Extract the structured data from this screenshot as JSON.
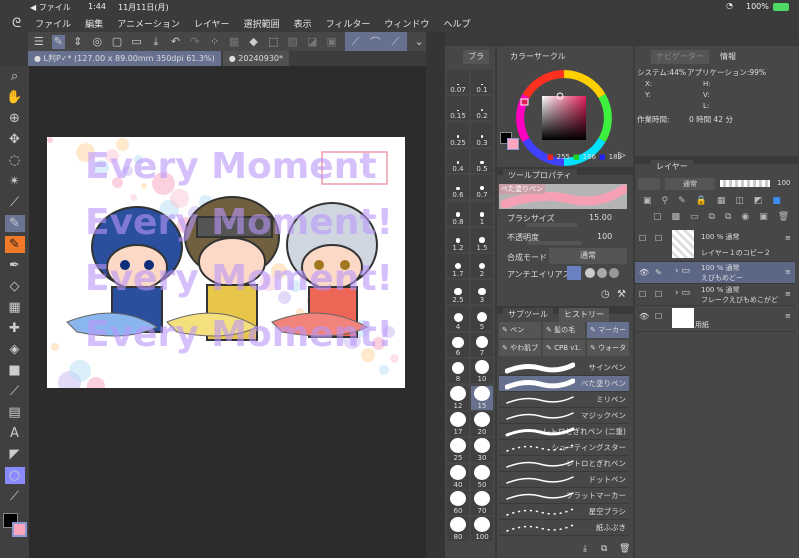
{
  "status": {
    "back": "◀ ファイル",
    "time": "1:44",
    "date": "11月11日(月)",
    "battery": "100%"
  },
  "menu": [
    "ファイル",
    "編集",
    "アニメーション",
    "レイヤー",
    "選択範囲",
    "表示",
    "フィルター",
    "ウィンドウ",
    "ヘルプ"
  ],
  "doc_tabs": [
    {
      "label": "● L判P✓* (127.00 x 89.00mm 350dpi 61.3%)",
      "active": true
    },
    {
      "label": "● 20240930*",
      "active": false
    }
  ],
  "artwork": {
    "text_lines": [
      "Every Moment",
      "Every Moment!",
      "Every Moment!",
      "Every Moment!"
    ]
  },
  "brush_panel": {
    "tab": "ブラ",
    "sizes": [
      "0.07",
      "0.1",
      "0.15",
      "0.2",
      "0.25",
      "0.3",
      "0.4",
      "0.5",
      "0.6",
      "0.7",
      "0.8",
      "1",
      "1.2",
      "1.5",
      "1.7",
      "2",
      "2.5",
      "3",
      "4",
      "5",
      "6",
      "7",
      "8",
      "10",
      "12",
      "15",
      "17",
      "20",
      "25",
      "30",
      "40",
      "50",
      "60",
      "70",
      "80",
      "100"
    ],
    "selected": "15"
  },
  "color_panel": {
    "tab": "カラーサークル",
    "r": "255",
    "g": "166",
    "b": "189",
    "main_color": "#000000",
    "sub_color": "#ffa6bd"
  },
  "tool_property": {
    "tab": "ツールプロパティ",
    "tool_name": "べた塗りペン",
    "brush_size_label": "ブラシサイズ",
    "brush_size": "15.00",
    "opacity_label": "不透明度",
    "opacity": "100",
    "blend_label": "合成モード",
    "blend": "通常",
    "aa_label": "アンチエイリアス"
  },
  "subtool": {
    "tab": "サブツール",
    "tab2": "ヒストリー",
    "groups": [
      "ペン",
      "髪の毛",
      "マーカー",
      "やわ肌ブ",
      "CPB v1.",
      "ウォータ"
    ],
    "items": [
      "サインペン",
      "べた塗りペン",
      "ミリペン",
      "マジックペン",
      "レトロとぎれペン (二重)",
      "シューティングスター",
      "レトロとぎれペン",
      "ドットペン",
      "フラットマーカー",
      "星空ブラシ",
      "紙ふぶき"
    ],
    "selected": "べた塗りペン"
  },
  "info_panel": {
    "tab_nav": "ナビゲーター",
    "tab": "情報",
    "system": "システム:44%",
    "app": "アプリケーション:99%",
    "x": "X:",
    "y": "Y:",
    "h": "H:",
    "v": "V:",
    "l": "L:",
    "work_time_label": "作業時間:",
    "work_time": "0 時間 42 分"
  },
  "layer_panel": {
    "tab": "レイヤー",
    "blend": "通常",
    "opacity": "100",
    "layers": [
      {
        "meta": "100 % 通常",
        "name": "レイヤー１のコピー２",
        "visible": false,
        "folder": false,
        "selected": false
      },
      {
        "meta": "100 % 通常",
        "name": "えびもめどー",
        "visible": true,
        "folder": true,
        "selected": true
      },
      {
        "meta": "100 % 通常",
        "name": "フレークえびもめこがど",
        "visible": false,
        "folder": true,
        "selected": false
      },
      {
        "meta": "",
        "name": "用紙",
        "visible": true,
        "folder": false,
        "selected": false
      }
    ]
  },
  "colors": {
    "accent": "#66708f",
    "panel": "#474747"
  }
}
